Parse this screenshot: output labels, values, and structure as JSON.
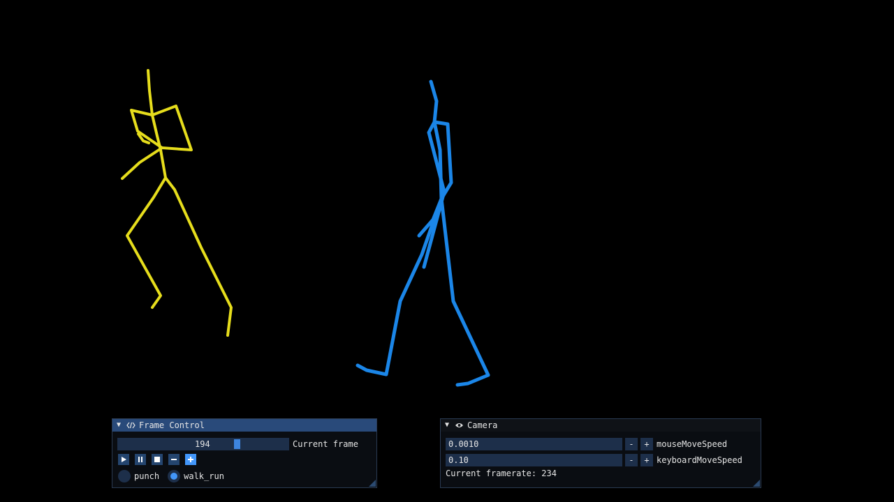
{
  "colors": {
    "skeleton_left": "#e6dd1c",
    "skeleton_right": "#1b86e8",
    "panel_header_active": "#294a7a",
    "accent": "#4296fa"
  },
  "frame_control": {
    "title": "Frame Control",
    "header_icon": "code-icon",
    "current_frame_value": "194",
    "current_frame_label": "Current frame",
    "buttons": [
      {
        "name": "play-button",
        "icon": "play-icon"
      },
      {
        "name": "pause-button",
        "icon": "pause-icon"
      },
      {
        "name": "stop-button",
        "icon": "stop-icon"
      },
      {
        "name": "prev-frame-button",
        "icon": "minus-icon"
      },
      {
        "name": "next-frame-button",
        "icon": "plus-icon"
      }
    ],
    "animations": [
      {
        "label": "punch",
        "selected": false
      },
      {
        "label": "walk_run",
        "selected": true
      }
    ]
  },
  "camera": {
    "title": "Camera",
    "header_icon": "eye-icon",
    "mouse_move_speed": "0.0010",
    "mouse_move_speed_label": "mouseMoveSpeed",
    "keyboard_move_speed": "0.10",
    "keyboard_move_speed_label": "keyboardMoveSpeed",
    "minus_symbol": "-",
    "plus_symbol": "+",
    "framerate_text": "Current framerate: 234"
  }
}
